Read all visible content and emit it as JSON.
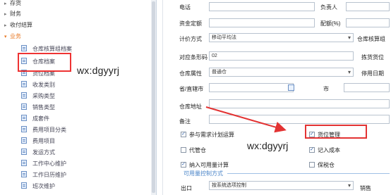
{
  "sidebar": {
    "top_items": [
      {
        "label": "存货"
      },
      {
        "label": "财务"
      },
      {
        "label": "收付结算"
      },
      {
        "label": "业务"
      }
    ],
    "children": [
      {
        "label": "仓库核算组档案"
      },
      {
        "label": "仓库档案"
      },
      {
        "label": "货位档案"
      },
      {
        "label": "收发类别"
      },
      {
        "label": "采购类型"
      },
      {
        "label": "销售类型"
      },
      {
        "label": "成套件"
      },
      {
        "label": "费用项目分类"
      },
      {
        "label": "费用项目"
      },
      {
        "label": "发运方式"
      },
      {
        "label": "工作中心维护"
      },
      {
        "label": "工作日历维护"
      },
      {
        "label": "班次维护"
      }
    ]
  },
  "watermark": "wx:dgyyrj",
  "form": {
    "phone_label": "电话",
    "person_label": "负责人",
    "quota_label": "资金定额",
    "distribution_label": "配额(%)",
    "costing_label": "计价方式",
    "costing_value": "移动平均法",
    "group_label": "仓库核算组",
    "barcode_label": "对应条形码",
    "barcode_value": "02",
    "pick_label": "拣货货位",
    "attr_label": "仓库属性",
    "attr_value": "普通仓",
    "stop_label": "停用日期",
    "province_label": "省/直辖市",
    "city_label": "市",
    "address_label": "仓库地址",
    "remark_label": "备注",
    "checks": {
      "mrp": "参与需求计划运算",
      "location": "货位管理",
      "consign": "代管仓",
      "cost": "记入成本",
      "available": "纳入可用量计算",
      "bonded": "保税仓"
    },
    "group_title": "可用量控制方式",
    "outbound_label": "出口",
    "outbound_value": "按系统选项控制",
    "sales_label": "销售"
  },
  "colors": {
    "annotation_red": "#e33333",
    "group_blue": "#4a84c8",
    "open_menu_orange": "#e87722"
  }
}
